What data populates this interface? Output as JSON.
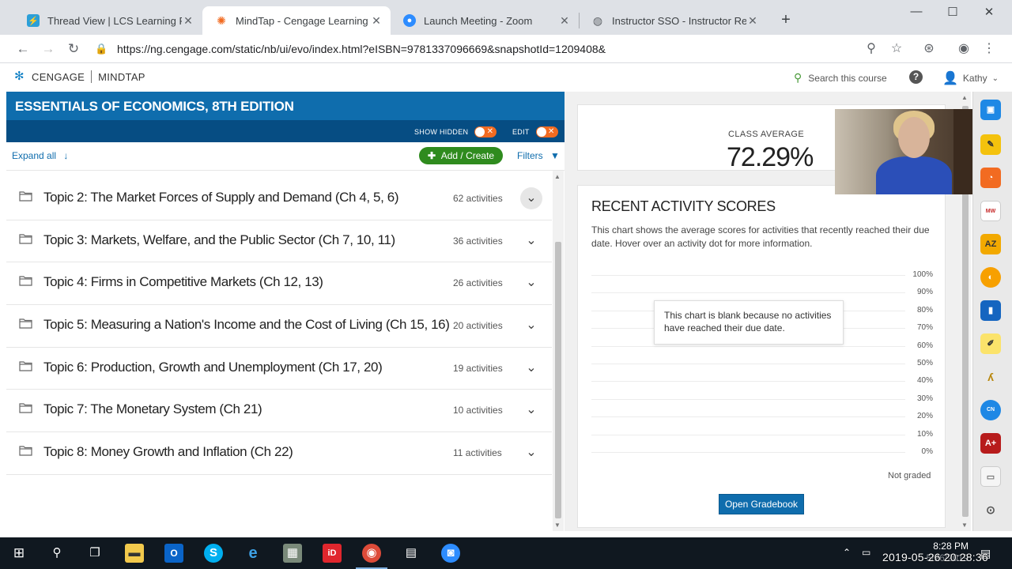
{
  "browser": {
    "tabs": [
      {
        "title": "Thread View | LCS Learning Platf",
        "icon": "lightning-icon",
        "color": "#2b9fd8"
      },
      {
        "title": "MindTap - Cengage Learning",
        "icon": "cengage-icon",
        "color": "#f26b21"
      },
      {
        "title": "Launch Meeting - Zoom",
        "icon": "zoom-icon",
        "color": "#2d8cff"
      },
      {
        "title": "Instructor SSO - Instructor Resou",
        "icon": "globe-icon",
        "color": "#5f6368"
      }
    ],
    "new_tab": "+",
    "url": "https://ng.cengage.com/static/nb/ui/evo/index.html?eISBN=9781337096669&snapshotId=1209408&"
  },
  "app": {
    "brand": "CENGAGE",
    "product": "MINDTAP",
    "search_placeholder": "Search this course",
    "help": "?",
    "user": "Kathy"
  },
  "course": {
    "title": "ESSENTIALS OF ECONOMICS, 8TH EDITION",
    "show_hidden_label": "SHOW HIDDEN",
    "edit_label": "EDIT",
    "toggle_off": "✕",
    "expand_all": "Expand all",
    "add_create": "Add / Create",
    "filters": "Filters"
  },
  "topics": [
    {
      "name": "Topic 2: The Market Forces of Supply and Demand (Ch 4, 5, 6)",
      "count": "62 activities"
    },
    {
      "name": "Topic 3: Markets, Welfare, and the Public Sector (Ch 7, 10, 11)",
      "count": "36 activities"
    },
    {
      "name": "Topic 4: Firms in Competitive Markets (Ch 12, 13)",
      "count": "26 activities"
    },
    {
      "name": "Topic 5: Measuring a Nation's Income and the Cost of Living (Ch 15, 16)",
      "count": "20 activities"
    },
    {
      "name": "Topic 6: Production, Growth and Unemployment (Ch 17, 20)",
      "count": "19 activities"
    },
    {
      "name": "Topic 7: The Monetary System (Ch 21)",
      "count": "10 activities"
    },
    {
      "name": "Topic 8: Money Growth and Inflation (Ch 22)",
      "count": "11 activities"
    }
  ],
  "class_average": {
    "label": "CLASS AVERAGE",
    "value": "72.29%"
  },
  "recent": {
    "title": "RECENT ACTIVITY SCORES",
    "description": "This chart shows the average scores for activities that recently reached their due date. Hover over an activity dot for more information.",
    "y_labels": [
      "100%",
      "90%",
      "80%",
      "70%",
      "60%",
      "50%",
      "40%",
      "30%",
      "20%",
      "10%",
      "0%"
    ],
    "blank_message": "This chart is blank because no activities have reached their due date.",
    "not_graded": "Not graded",
    "open_gradebook": "Open Gradebook"
  },
  "taskbar": {
    "time": "8:28 PM",
    "date": "5/26/2019",
    "recording_stamp": "2019-05-26 20:28:36"
  }
}
